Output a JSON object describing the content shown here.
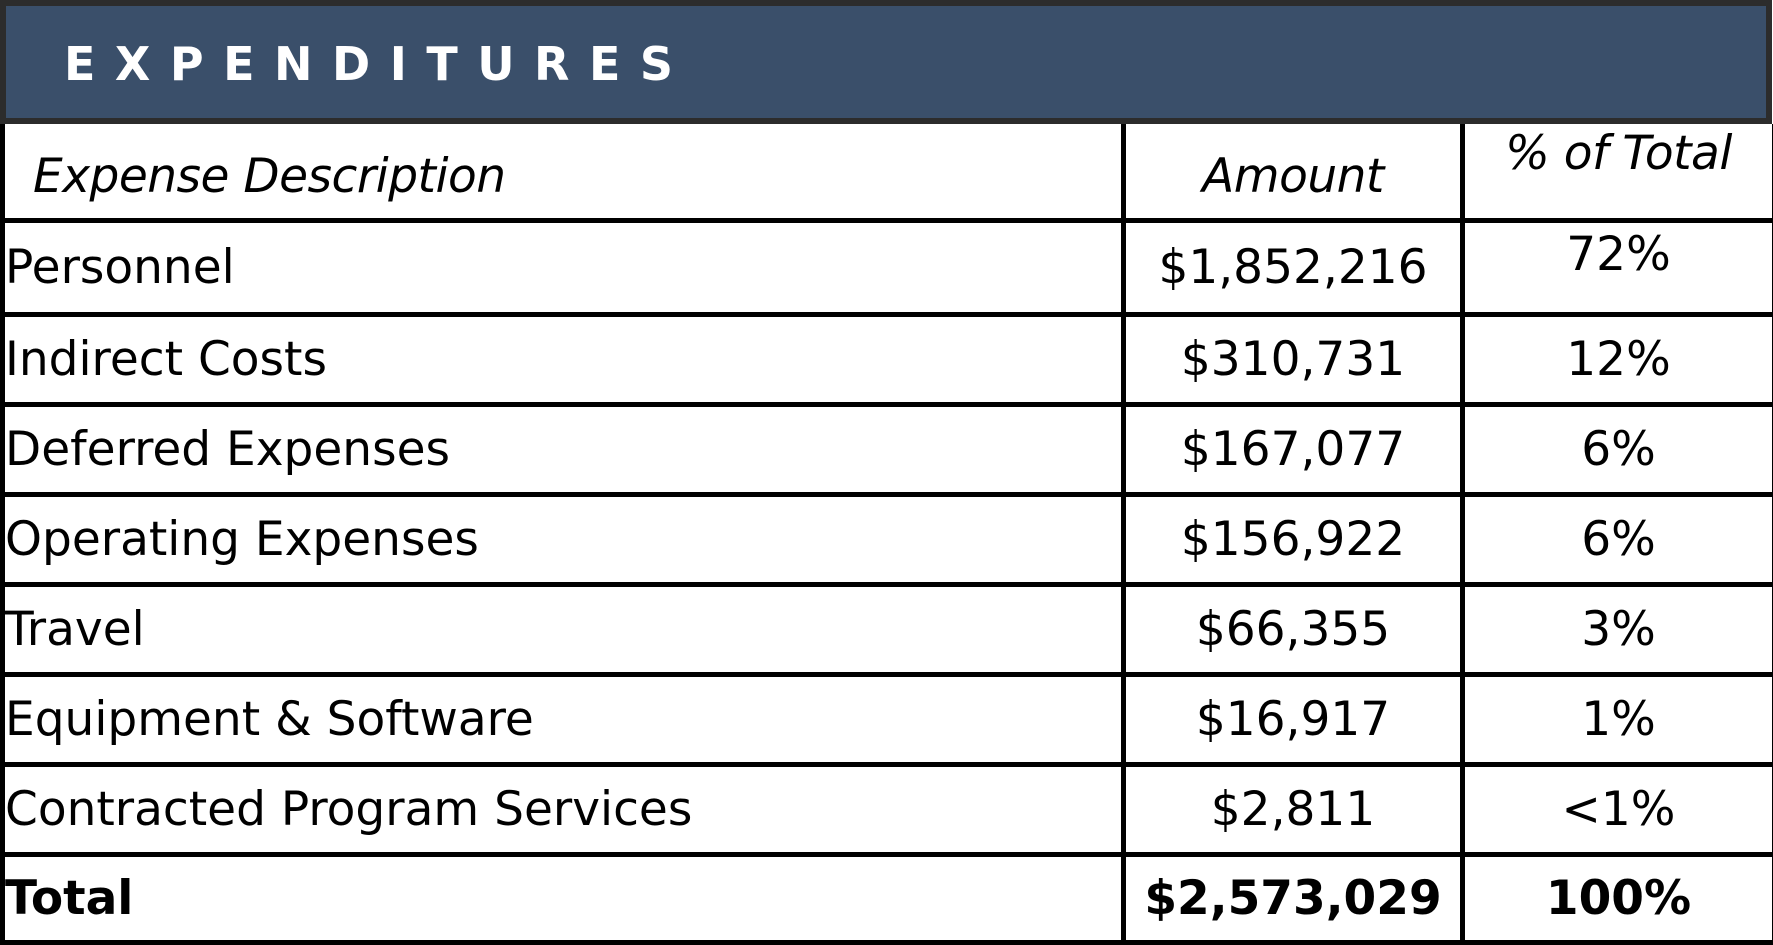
{
  "title": "EXPENDITURES",
  "colors": {
    "banner": "#3a4f6a",
    "banner_frame": "#2c2c2c",
    "title_text": "#ffffff",
    "grid": "#000000"
  },
  "table": {
    "headers": {
      "description": "Expense Description",
      "amount": "Amount",
      "percent": "% of Total"
    },
    "rows": [
      {
        "description": "Personnel",
        "amount": "$1,852,216",
        "percent": "72%"
      },
      {
        "description": "Indirect Costs",
        "amount": "$310,731",
        "percent": "12%"
      },
      {
        "description": "Deferred Expenses",
        "amount": "$167,077",
        "percent": "6%"
      },
      {
        "description": "Operating Expenses",
        "amount": "$156,922",
        "percent": "6%"
      },
      {
        "description": "Travel",
        "amount": "$66,355",
        "percent": "3%"
      },
      {
        "description": "Equipment & Software",
        "amount": "$16,917",
        "percent": "1%"
      },
      {
        "description": "Contracted Program Services",
        "amount": "$2,811",
        "percent": "<1%"
      }
    ],
    "total": {
      "description": "Total",
      "amount": "$2,573,029",
      "percent": "100%"
    }
  }
}
